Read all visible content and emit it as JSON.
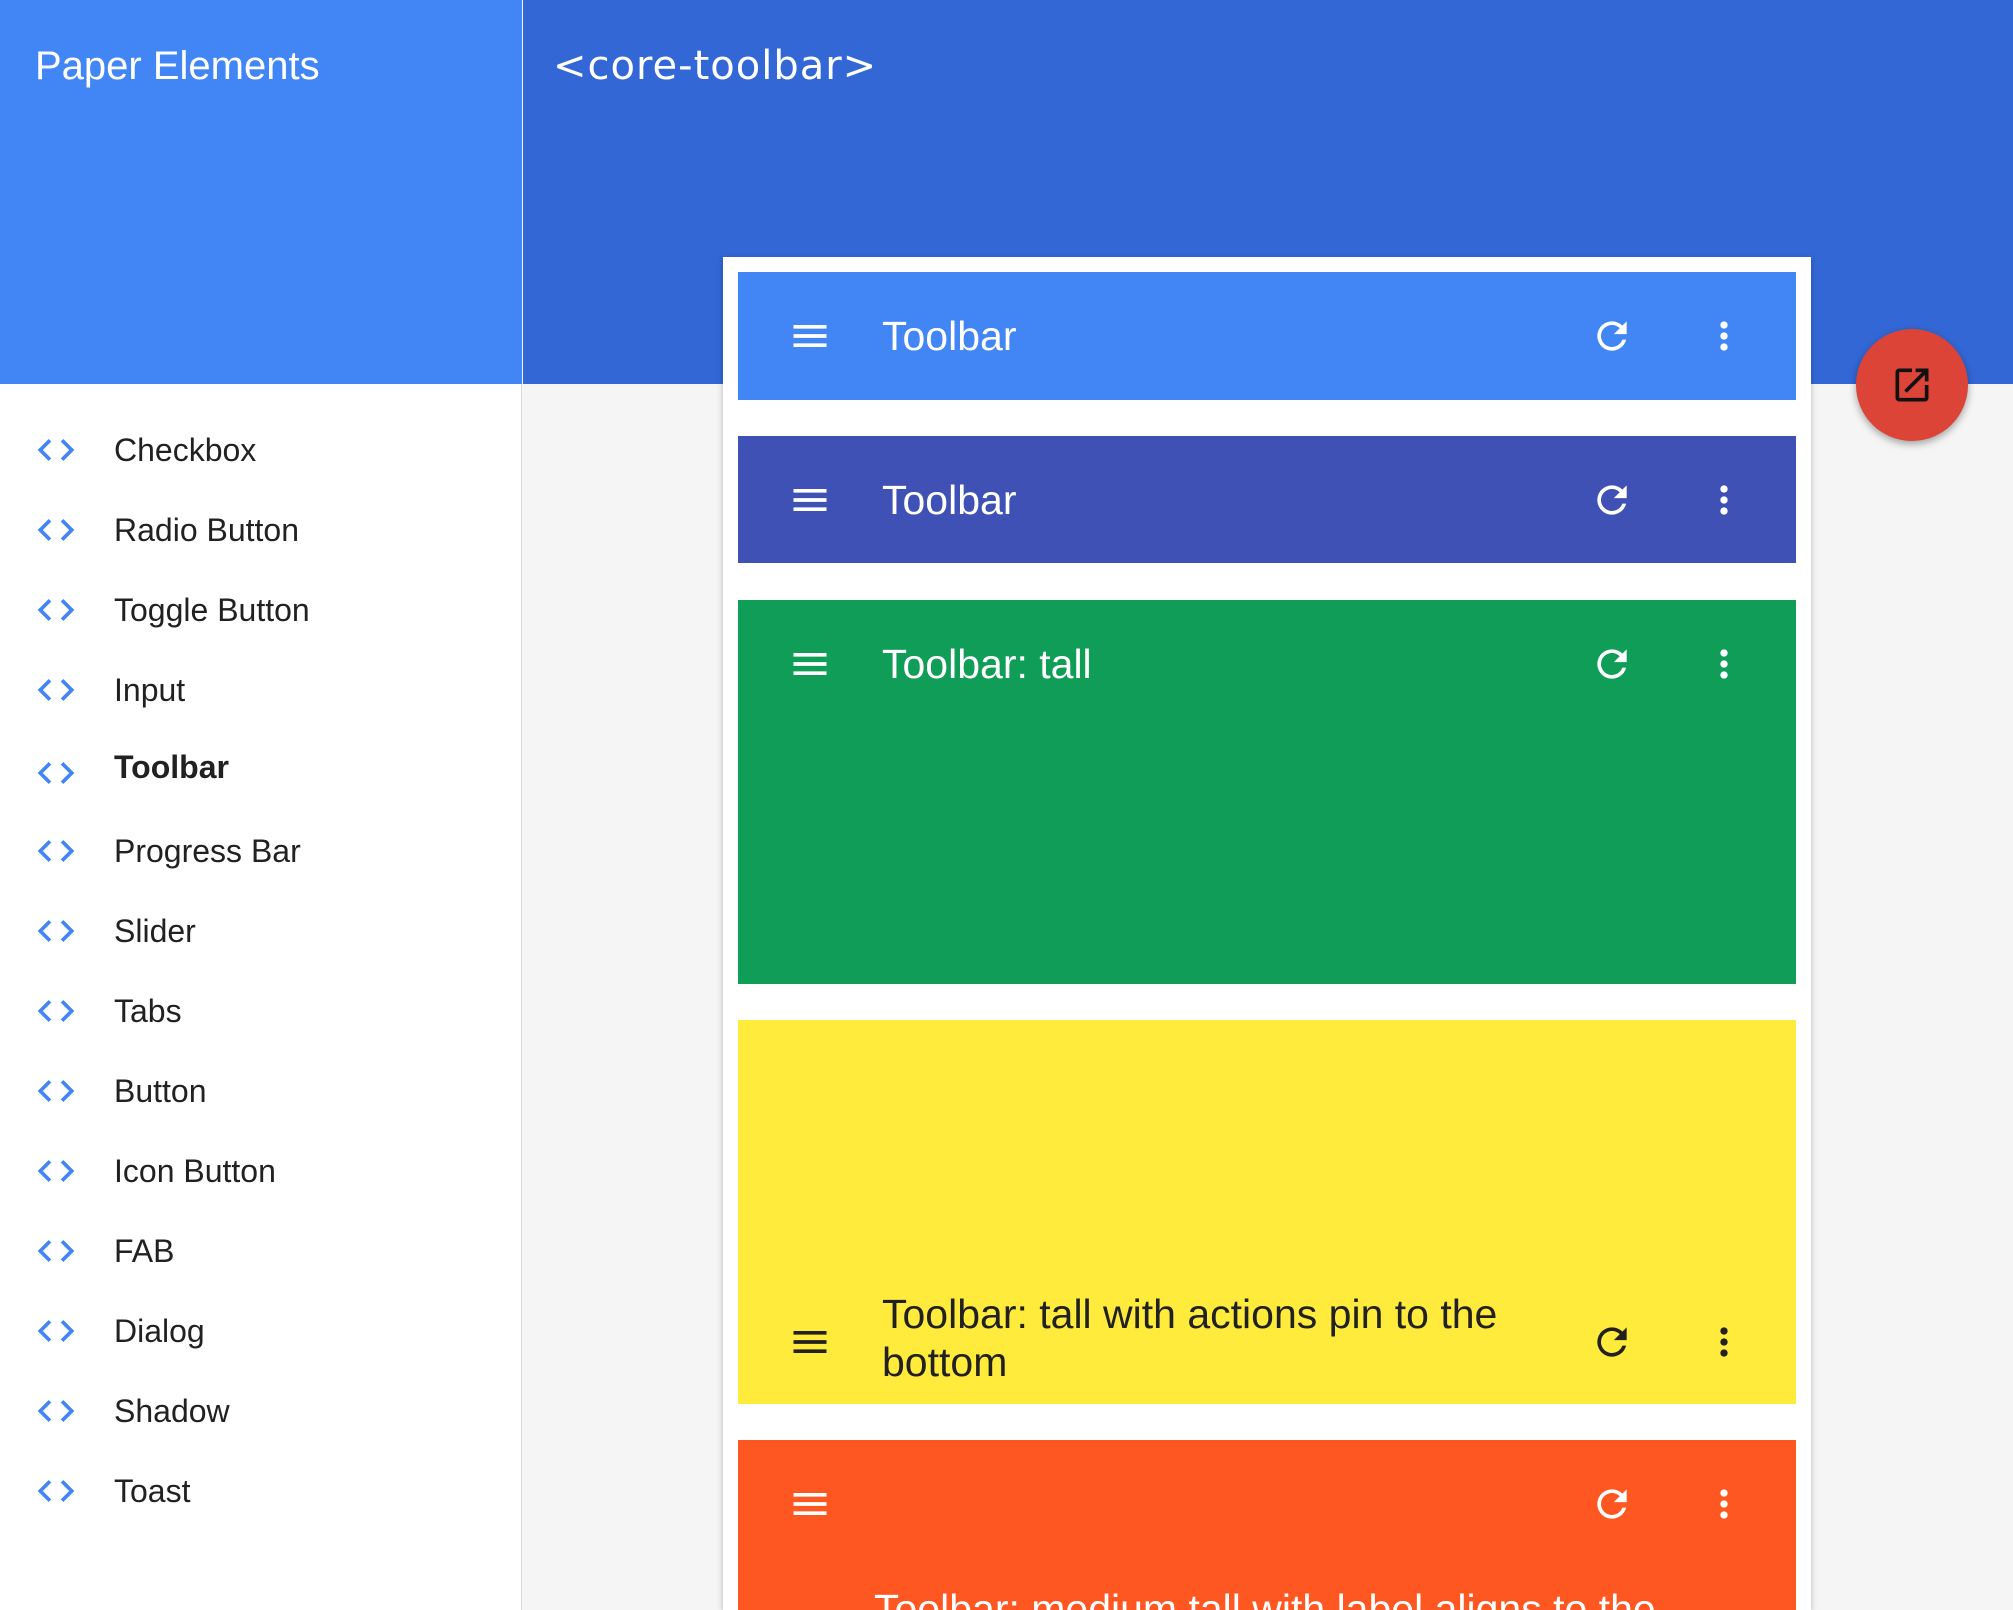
{
  "drawer": {
    "title": "Paper Elements",
    "items": [
      {
        "label": "Checkbox",
        "icon": "code-icon"
      },
      {
        "label": "Radio Button",
        "icon": "code-icon"
      },
      {
        "label": "Toggle Button",
        "icon": "code-icon"
      },
      {
        "label": "Input",
        "icon": "code-icon"
      },
      {
        "label": "Toolbar",
        "icon": "code-icon",
        "selected": true
      },
      {
        "label": "Progress Bar",
        "icon": "code-icon"
      },
      {
        "label": "Slider",
        "icon": "code-icon"
      },
      {
        "label": "Tabs",
        "icon": "code-icon"
      },
      {
        "label": "Button",
        "icon": "code-icon"
      },
      {
        "label": "Icon Button",
        "icon": "code-icon"
      },
      {
        "label": "FAB",
        "icon": "code-icon"
      },
      {
        "label": "Dialog",
        "icon": "code-icon"
      },
      {
        "label": "Shadow",
        "icon": "code-icon"
      },
      {
        "label": "Toast",
        "icon": "code-icon"
      }
    ]
  },
  "main": {
    "title": "<core-toolbar>",
    "fab_icon": "open-in-new-icon",
    "toolbars": [
      {
        "title": "Toolbar",
        "color": "#4285f4"
      },
      {
        "title": "Toolbar",
        "color": "#3f51b5"
      },
      {
        "title": "Toolbar: tall",
        "color": "#0f9d58"
      },
      {
        "title_line1": "Toolbar: tall with actions pin to the",
        "title_line2": "bottom",
        "color": "#ffeb3b"
      },
      {
        "title": "Toolbar: medium tall with label aligns to the",
        "color": "#ff5722"
      }
    ]
  },
  "colors": {
    "drawer_header": "#4285f4",
    "main_header": "#3367d6",
    "fab": "#db4437",
    "code_icon": "#4285f4"
  }
}
